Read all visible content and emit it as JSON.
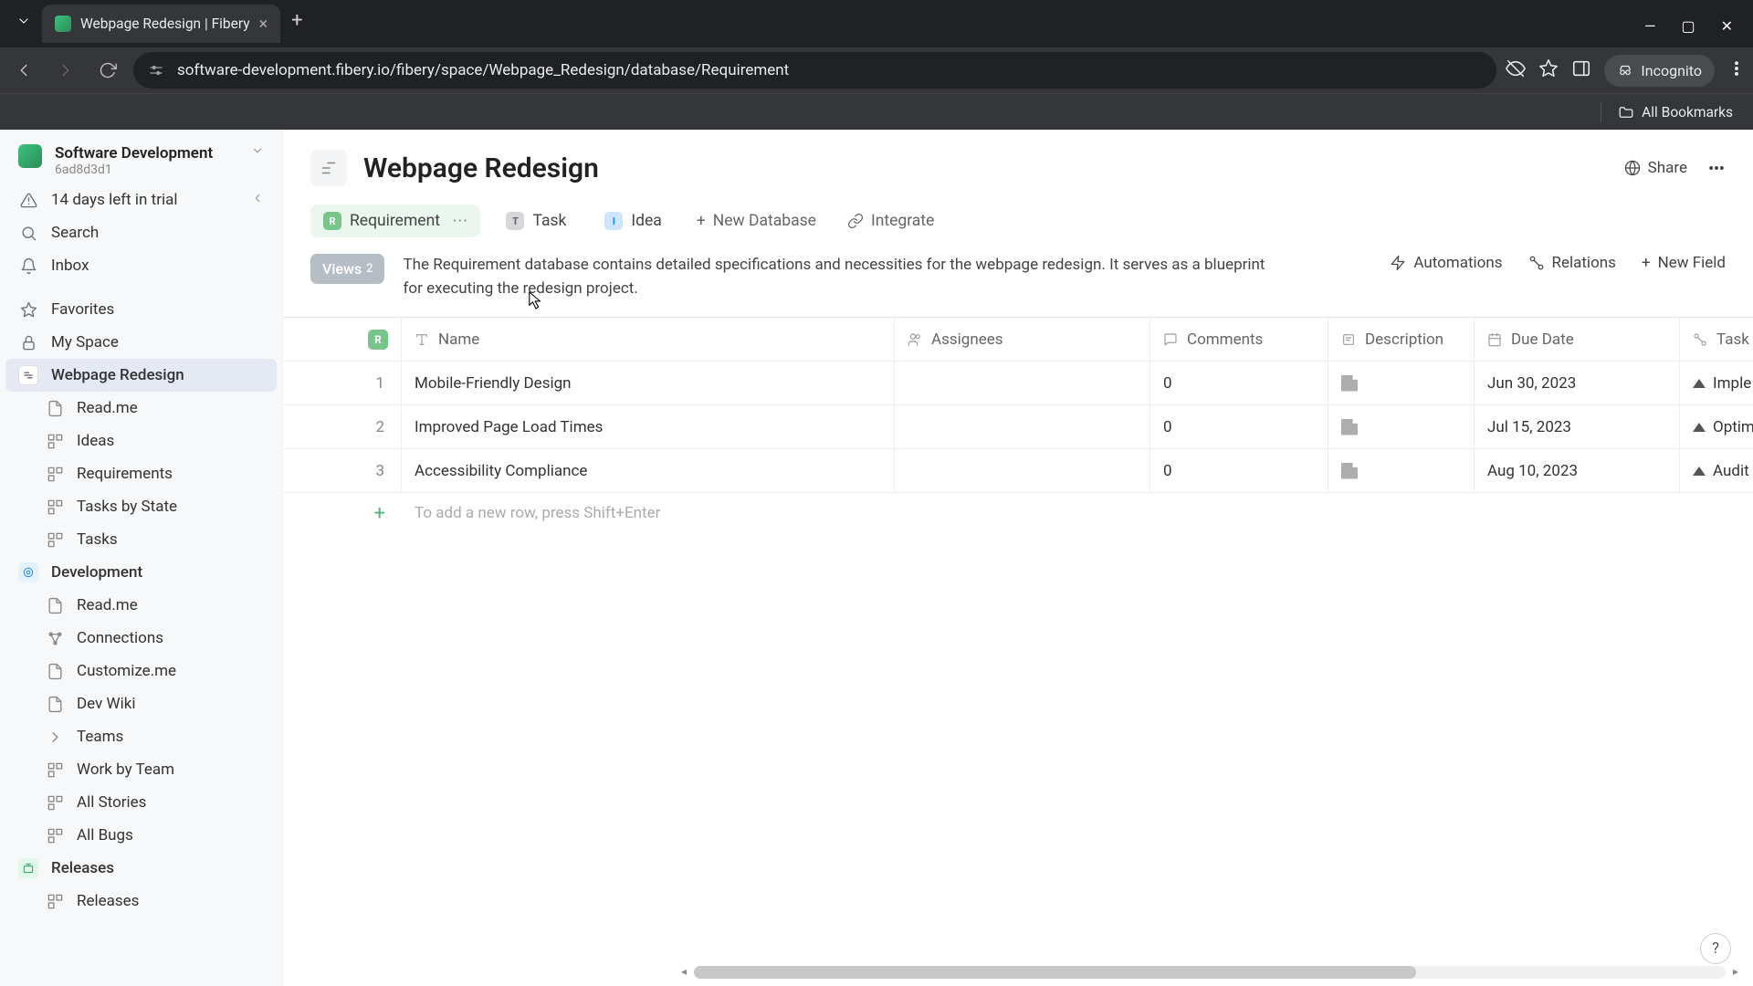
{
  "browser": {
    "tab_title": "Webpage Redesign | Fibery",
    "url": "software-development.fibery.io/fibery/space/Webpage_Redesign/database/Requirement",
    "incognito_label": "Incognito",
    "all_bookmarks": "All Bookmarks"
  },
  "workspace": {
    "name": "Software Development",
    "id": "6ad8d3d1",
    "trial_notice": "14 days left in trial"
  },
  "sidebar": {
    "search": "Search",
    "inbox": "Inbox",
    "favorites": "Favorites",
    "my_space": "My Space",
    "spaces": [
      {
        "name": "Webpage Redesign",
        "active": true,
        "children": [
          "Read.me",
          "Ideas",
          "Requirements",
          "Tasks by State",
          "Tasks"
        ]
      },
      {
        "name": "Development",
        "children": [
          "Read.me",
          "Connections",
          "Customize.me",
          "Dev Wiki",
          "Teams",
          "Work by Team",
          "All Stories",
          "All Bugs"
        ]
      },
      {
        "name": "Releases",
        "children": [
          "Releases"
        ]
      }
    ]
  },
  "page": {
    "title": "Webpage Redesign",
    "share": "Share",
    "db_tabs": [
      {
        "label": "Requirement",
        "badge_color": "#77c58a",
        "badge_letter": "R",
        "active": true
      },
      {
        "label": "Task",
        "badge_color": "#d5d7db",
        "badge_letter": "T"
      },
      {
        "label": "Idea",
        "badge_color": "#cfe5ff",
        "badge_letter": "I"
      }
    ],
    "new_database": "New Database",
    "integrate": "Integrate",
    "views_label": "Views",
    "views_count": "2",
    "description": "The Requirement database contains detailed specifications and necessities for the webpage redesign. It serves as a blueprint for executing the redesign project.",
    "automations": "Automations",
    "relations": "Relations",
    "new_field": "New Field"
  },
  "table": {
    "columns": [
      "Name",
      "Assignees",
      "Comments",
      "Description",
      "Due Date",
      "Task"
    ],
    "rows": [
      {
        "n": "1",
        "name": "Mobile-Friendly Design",
        "assignees": "",
        "comments": "0",
        "due": "Jun 30, 2023",
        "task": "Imple"
      },
      {
        "n": "2",
        "name": "Improved Page Load Times",
        "assignees": "",
        "comments": "0",
        "due": "Jul 15, 2023",
        "task": "Optim"
      },
      {
        "n": "3",
        "name": "Accessibility Compliance",
        "assignees": "",
        "comments": "0",
        "due": "Aug 10, 2023",
        "task": "Audit"
      }
    ],
    "add_hint": "To add a new row, press Shift+Enter"
  }
}
